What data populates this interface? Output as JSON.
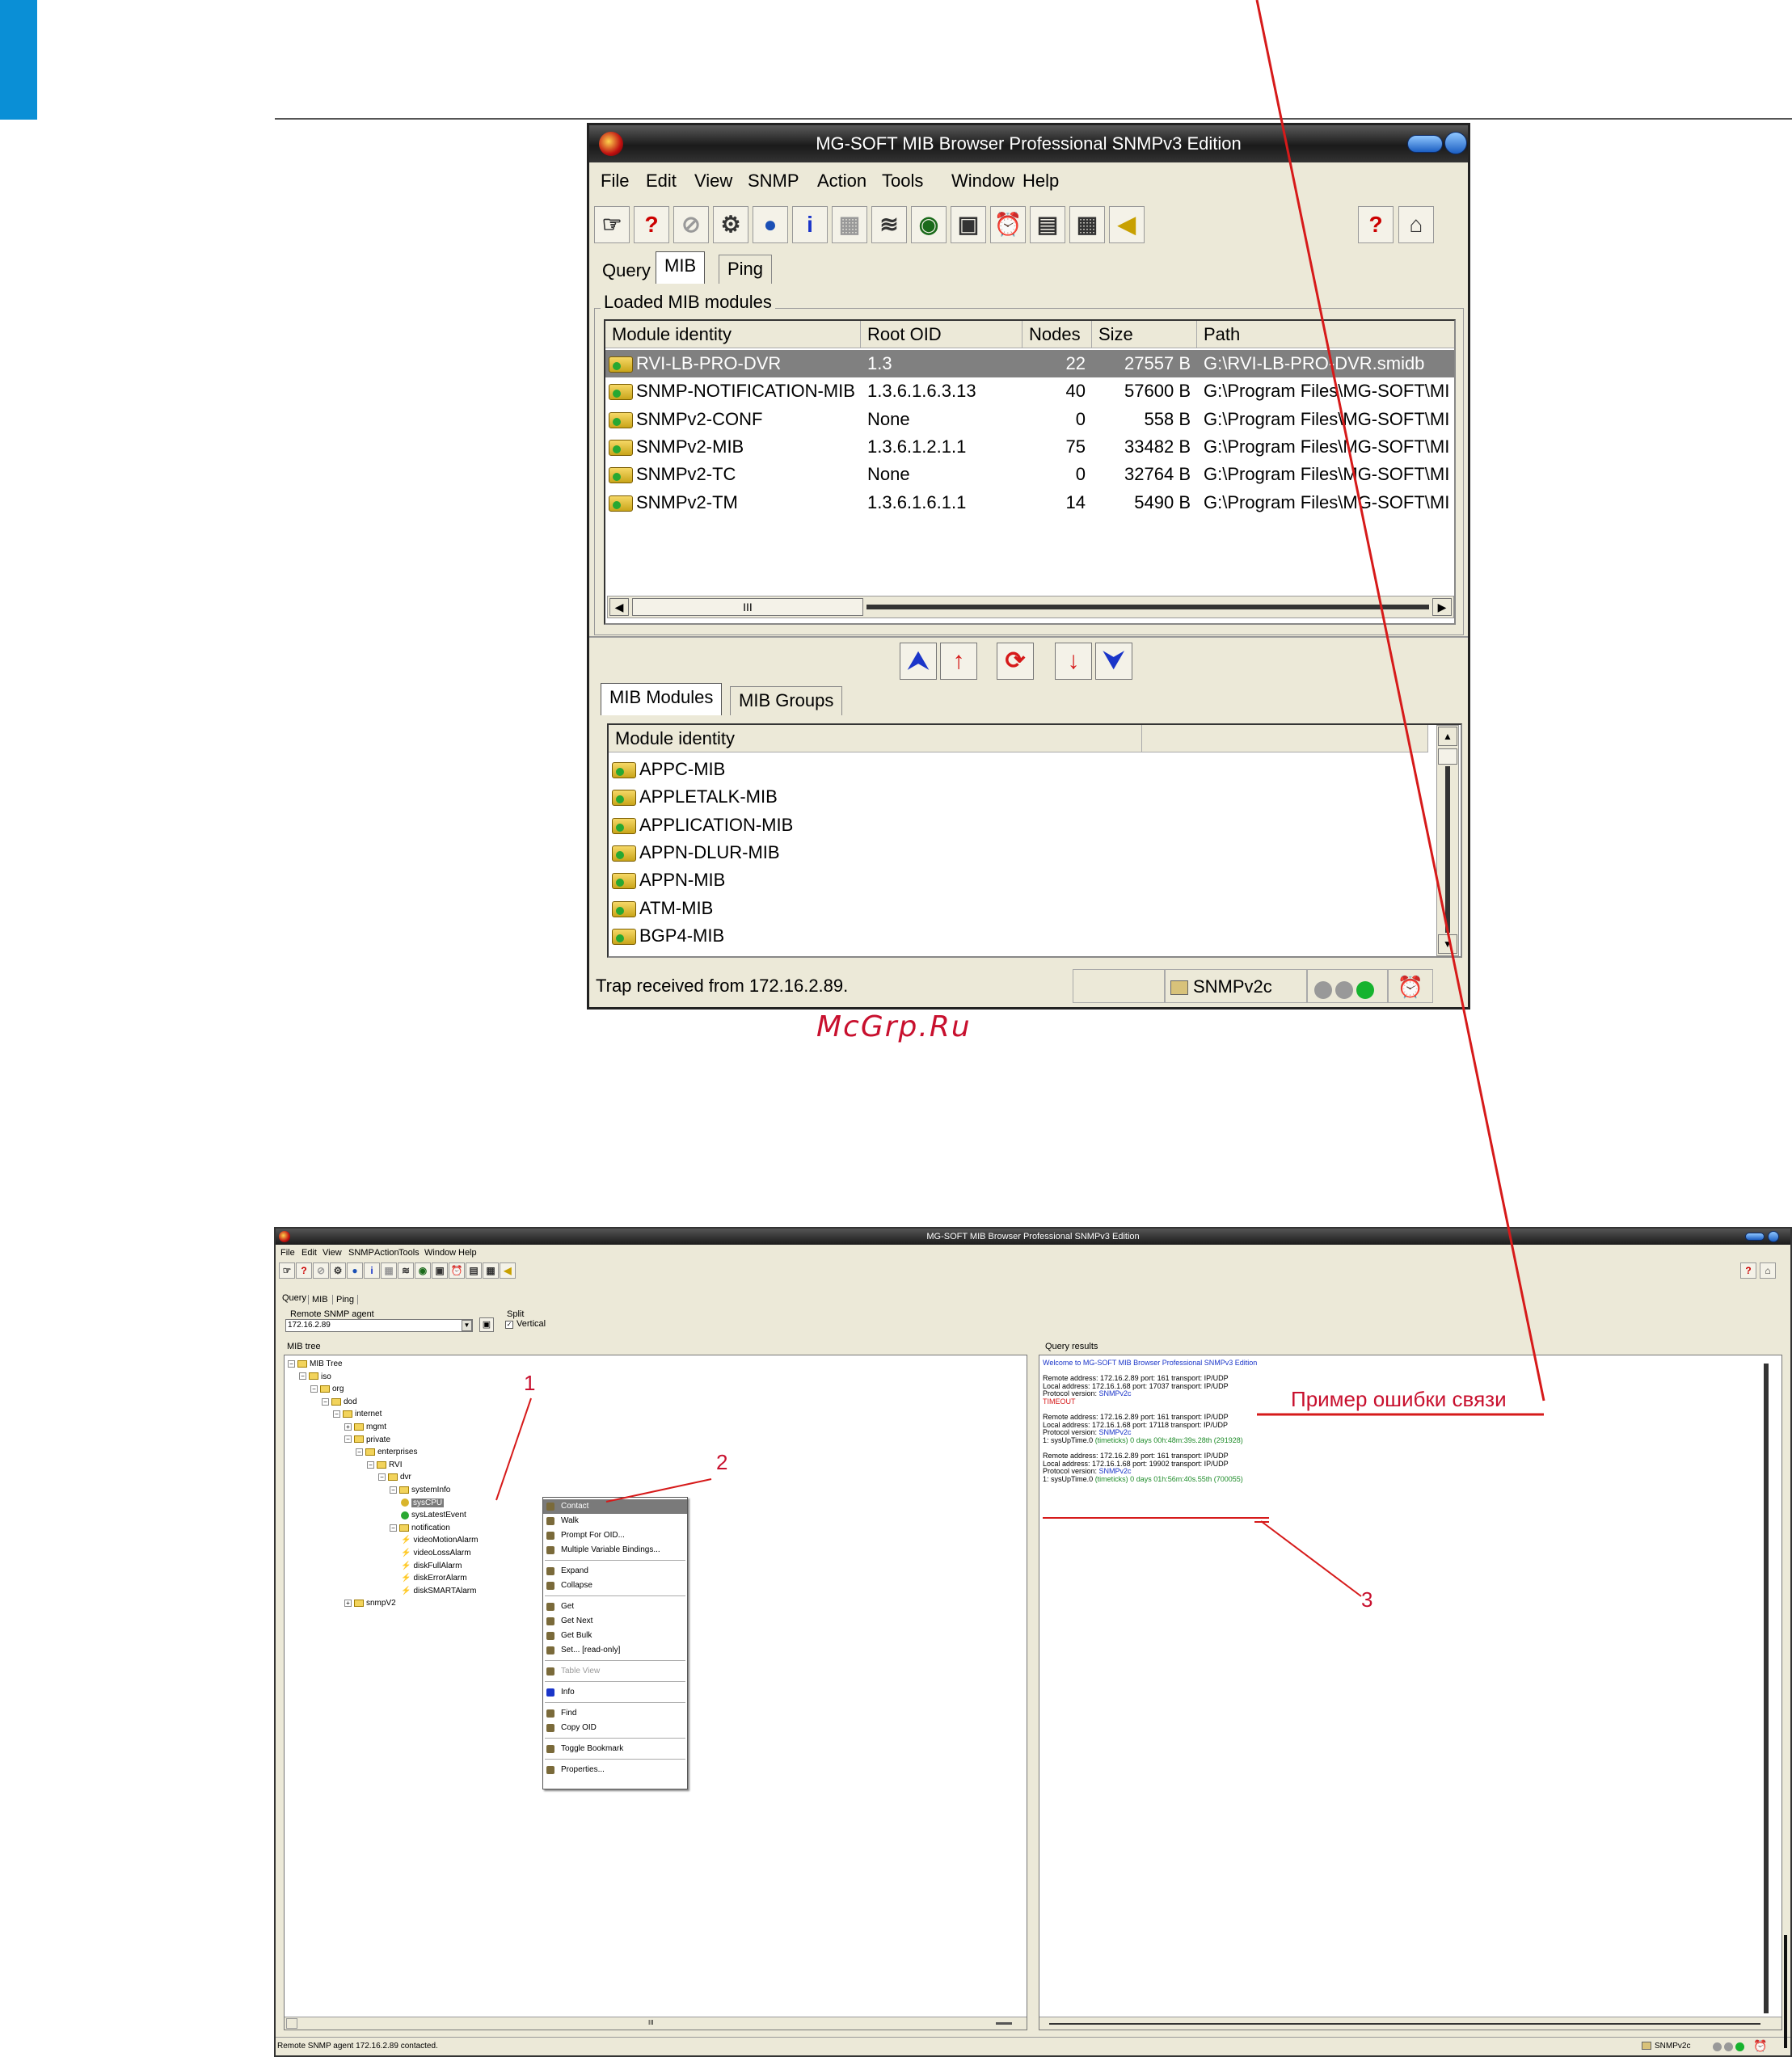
{
  "window1": {
    "title": "MG-SOFT MIB Browser Professional SNMPv3 Edition",
    "menu": [
      "File",
      "Edit",
      "View",
      "SNMP",
      "Action",
      "Tools",
      "Window",
      "Help"
    ],
    "tabs": [
      "Query",
      "MIB",
      "Ping"
    ],
    "active_tab": "MIB",
    "loaded_group_label": "Loaded MIB modules",
    "columns": [
      "Module identity",
      "Root OID",
      "Nodes",
      "Size",
      "Path"
    ],
    "rows": [
      {
        "module": "RVI-LB-PRO-DVR",
        "oid": "1.3",
        "nodes": "22",
        "size": "27557 B",
        "path": "G:\\RVI-LB-PRO-DVR.smidb"
      },
      {
        "module": "SNMP-NOTIFICATION-MIB",
        "oid": "1.3.6.1.6.3.13",
        "nodes": "40",
        "size": "57600 B",
        "path": "G:\\Program Files\\MG-SOFT\\MI"
      },
      {
        "module": "SNMPv2-CONF",
        "oid": "None",
        "nodes": "0",
        "size": "558 B",
        "path": "G:\\Program Files\\MG-SOFT\\MI"
      },
      {
        "module": "SNMPv2-MIB",
        "oid": "1.3.6.1.2.1.1",
        "nodes": "75",
        "size": "33482 B",
        "path": "G:\\Program Files\\MG-SOFT\\MI"
      },
      {
        "module": "SNMPv2-TC",
        "oid": "None",
        "nodes": "0",
        "size": "32764 B",
        "path": "G:\\Program Files\\MG-SOFT\\MI"
      },
      {
        "module": "SNMPv2-TM",
        "oid": "1.3.6.1.6.1.1",
        "nodes": "14",
        "size": "5490 B",
        "path": "G:\\Program Files\\MG-SOFT\\MI"
      }
    ],
    "scroll_grip": "III",
    "lower_tabs": [
      "MIB Modules",
      "MIB Groups"
    ],
    "lower_column": "Module identity",
    "lower_rows": [
      "APPC-MIB",
      "APPLETALK-MIB",
      "APPLICATION-MIB",
      "APPN-DLUR-MIB",
      "APPN-MIB",
      "ATM-MIB",
      "BGP4-MIB"
    ],
    "status_text": "Trap received from 172.16.2.89.",
    "snmp_version": "SNMPv2c",
    "toolbar_glyphs": [
      "☞",
      "?",
      "⊘",
      "⚙",
      "●",
      "i",
      "▦",
      "≋",
      "◉",
      "▣",
      "⏰",
      "▤",
      "▦",
      "◀",
      "?",
      "⌂"
    ],
    "arrow_glyphs": [
      "⮝",
      "↑",
      "⟳",
      "↓",
      "⮟"
    ]
  },
  "watermark": "McGrp.Ru",
  "window2": {
    "title": "MG-SOFT MIB Browser Professional SNMPv3 Edition",
    "menu": [
      "File",
      "Edit",
      "View",
      "SNMP",
      "Action",
      "Tools",
      "Window",
      "Help"
    ],
    "tabs": [
      "Query",
      "MIB",
      "Ping"
    ],
    "agent_label": "Remote SNMP agent",
    "agent_value": "172.16.2.89",
    "split_label": "Split",
    "vertical_label": "Vertical",
    "tree_label": "MIB tree",
    "results_label": "Query results",
    "tree": [
      {
        "text": "MIB Tree",
        "level": 0,
        "kind": "root"
      },
      {
        "text": "iso",
        "level": 1,
        "kind": "folder"
      },
      {
        "text": "org",
        "level": 2,
        "kind": "folder"
      },
      {
        "text": "dod",
        "level": 3,
        "kind": "folder"
      },
      {
        "text": "internet",
        "level": 4,
        "kind": "folder"
      },
      {
        "text": "mgmt",
        "level": 5,
        "kind": "folder"
      },
      {
        "text": "private",
        "level": 5,
        "kind": "folder"
      },
      {
        "text": "enterprises",
        "level": 6,
        "kind": "folder"
      },
      {
        "text": "RVI",
        "level": 7,
        "kind": "folder"
      },
      {
        "text": "dvr",
        "level": 8,
        "kind": "folder"
      },
      {
        "text": "systemInfo",
        "level": 9,
        "kind": "folder"
      },
      {
        "text": "sysCPU",
        "level": 10,
        "kind": "leaf-sel"
      },
      {
        "text": "sysLatestEvent",
        "level": 10,
        "kind": "leaf"
      },
      {
        "text": "notification",
        "level": 9,
        "kind": "folder"
      },
      {
        "text": "videoMotionAlarm",
        "level": 10,
        "kind": "notify"
      },
      {
        "text": "videoLossAlarm",
        "level": 10,
        "kind": "notify"
      },
      {
        "text": "diskFullAlarm",
        "level": 10,
        "kind": "notify"
      },
      {
        "text": "diskErrorAlarm",
        "level": 10,
        "kind": "notify"
      },
      {
        "text": "diskSMARTAlarm",
        "level": 10,
        "kind": "notify"
      },
      {
        "text": "snmpV2",
        "level": 5,
        "kind": "folder"
      }
    ],
    "context_menu": [
      {
        "label": "Contact",
        "state": "hi"
      },
      {
        "label": "Walk"
      },
      {
        "label": "Prompt For OID..."
      },
      {
        "label": "Multiple Variable Bindings..."
      },
      {
        "sep": true
      },
      {
        "label": "Expand"
      },
      {
        "label": "Collapse"
      },
      {
        "sep": true
      },
      {
        "label": "Get"
      },
      {
        "label": "Get Next"
      },
      {
        "label": "Get Bulk"
      },
      {
        "label": "Set...  [read-only]"
      },
      {
        "sep": true
      },
      {
        "label": "Table View",
        "state": "dis"
      },
      {
        "sep": true
      },
      {
        "label": "Info"
      },
      {
        "sep": true
      },
      {
        "label": "Find"
      },
      {
        "label": "Copy OID"
      },
      {
        "sep": true
      },
      {
        "label": "Toggle Bookmark"
      },
      {
        "sep": true
      },
      {
        "label": "Properties..."
      }
    ],
    "results": [
      {
        "k": "Welcome to MG-SOFT MIB Browser Professional SNMPv3 Edition",
        "v": "",
        "c": "blue"
      },
      {
        "k": "",
        "v": "",
        "c": ""
      },
      {
        "k": "Remote address: 172.16.2.89  port: 161 transport: IP/UDP",
        "v": "",
        "c": ""
      },
      {
        "k": "Local address: 172.16.1.68  port: 17037 transport: IP/UDP",
        "v": "",
        "c": ""
      },
      {
        "k": "Protocol version: ",
        "v": "SNMPv2c",
        "c": "blue"
      },
      {
        "k": "TIMEOUT",
        "v": "",
        "c": "red"
      },
      {
        "k": "",
        "v": "",
        "c": ""
      },
      {
        "k": "Remote address: 172.16.2.89  port: 161 transport: IP/UDP",
        "v": "",
        "c": ""
      },
      {
        "k": "Local address: 172.16.1.68  port: 17118 transport: IP/UDP",
        "v": "",
        "c": ""
      },
      {
        "k": "Protocol version: ",
        "v": "SNMPv2c",
        "c": "blue"
      },
      {
        "k": "1: sysUpTime.0 ",
        "v": "(timeticks) 0 days 00h:48m:39s.28th (291928)",
        "c": "mix"
      },
      {
        "k": "",
        "v": "",
        "c": ""
      },
      {
        "k": "Remote address: 172.16.2.89  port: 161 transport: IP/UDP",
        "v": "",
        "c": ""
      },
      {
        "k": "Local address: 172.16.1.68  port: 19902 transport: IP/UDP",
        "v": "",
        "c": ""
      },
      {
        "k": "Protocol version: ",
        "v": "SNMPv2c",
        "c": "blue"
      },
      {
        "k": "1: sysUpTime.0 ",
        "v": "(timeticks) 0 days 01h:56m:40s.55th (700055)",
        "c": "mix"
      }
    ],
    "annotation_title": "Пример ошибки связи",
    "callouts": [
      "1",
      "2",
      "3"
    ],
    "status_text": "Remote SNMP agent 172.16.2.89 contacted.",
    "snmp_version": "SNMPv2c"
  }
}
